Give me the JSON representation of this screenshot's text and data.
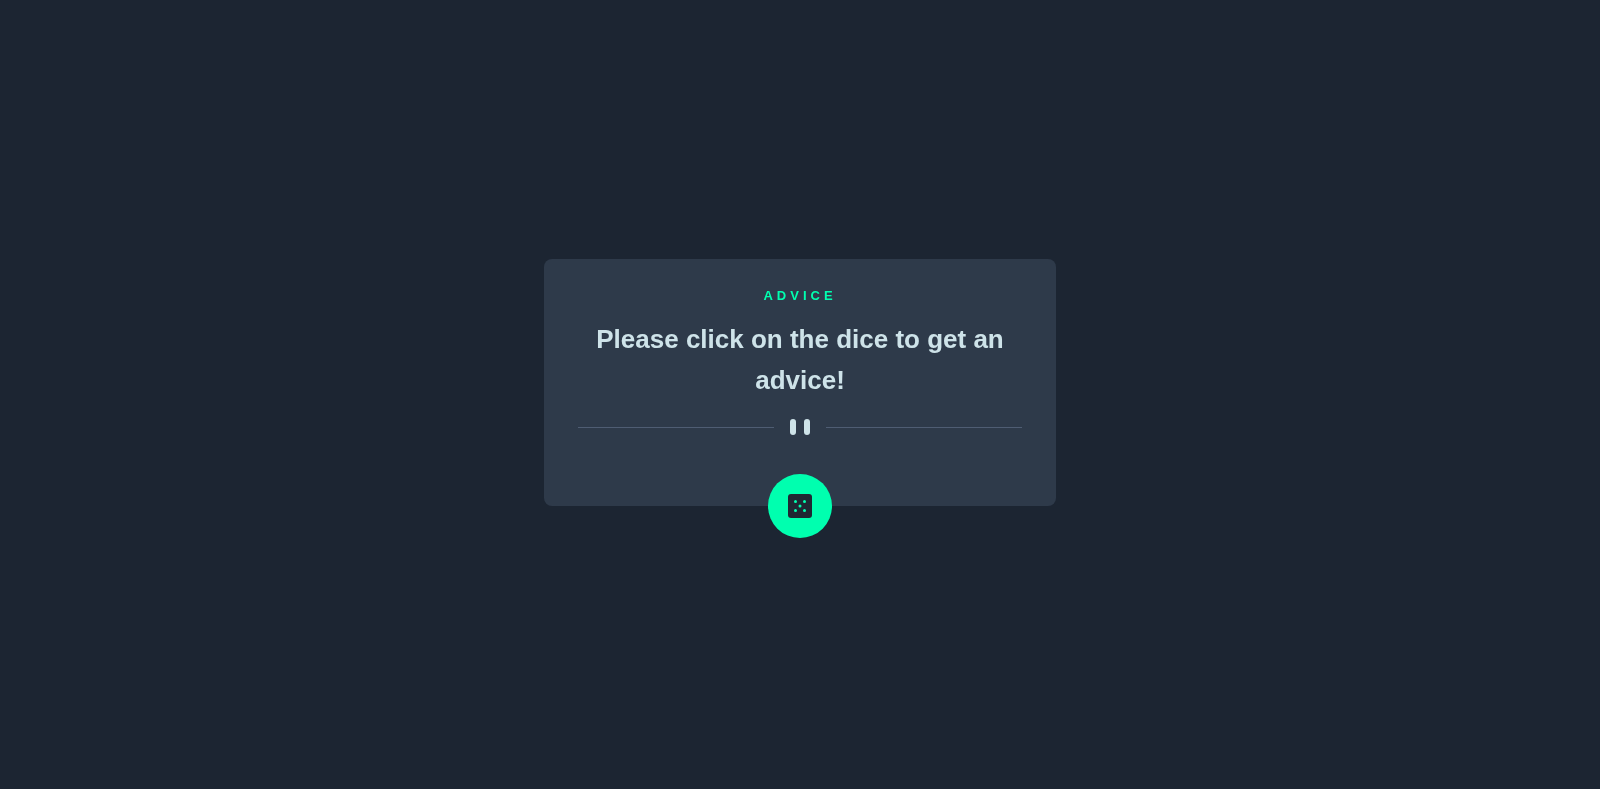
{
  "card": {
    "label": "ADVICE",
    "quote": "Please click on the dice to get an advice!"
  }
}
